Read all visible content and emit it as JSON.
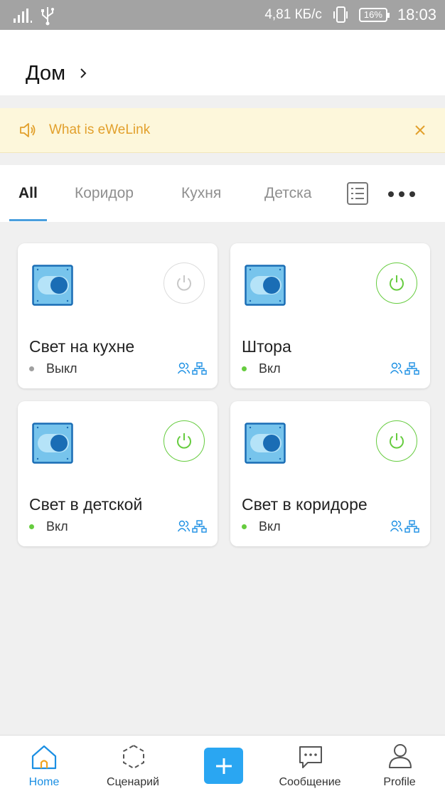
{
  "status_bar": {
    "speed": "4,81 КБ/с",
    "battery": "16%",
    "time": "18:03"
  },
  "header": {
    "home_title": "Дом"
  },
  "banner": {
    "text": "What is eWeLink"
  },
  "tabs": [
    {
      "label": "All",
      "active": true
    },
    {
      "label": "Коридор",
      "active": false
    },
    {
      "label": "Кухня",
      "active": false
    },
    {
      "label": "Детска",
      "active": false
    }
  ],
  "devices": [
    {
      "name": "Свет на кухне",
      "status": "Выкл",
      "on": false
    },
    {
      "name": "Штора",
      "status": "Вкл",
      "on": true
    },
    {
      "name": "Свет в детской",
      "status": "Вкл",
      "on": true
    },
    {
      "name": "Свет в коридоре",
      "status": "Вкл",
      "on": true
    }
  ],
  "bottom_nav": {
    "home": "Home",
    "scenes": "Сценарий",
    "messages": "Сообщение",
    "profile": "Profile"
  },
  "colors": {
    "accent": "#1b8fe3",
    "on_green": "#66cc3f",
    "banner_text": "#e2a02c",
    "add_button": "#2aa6f2"
  }
}
